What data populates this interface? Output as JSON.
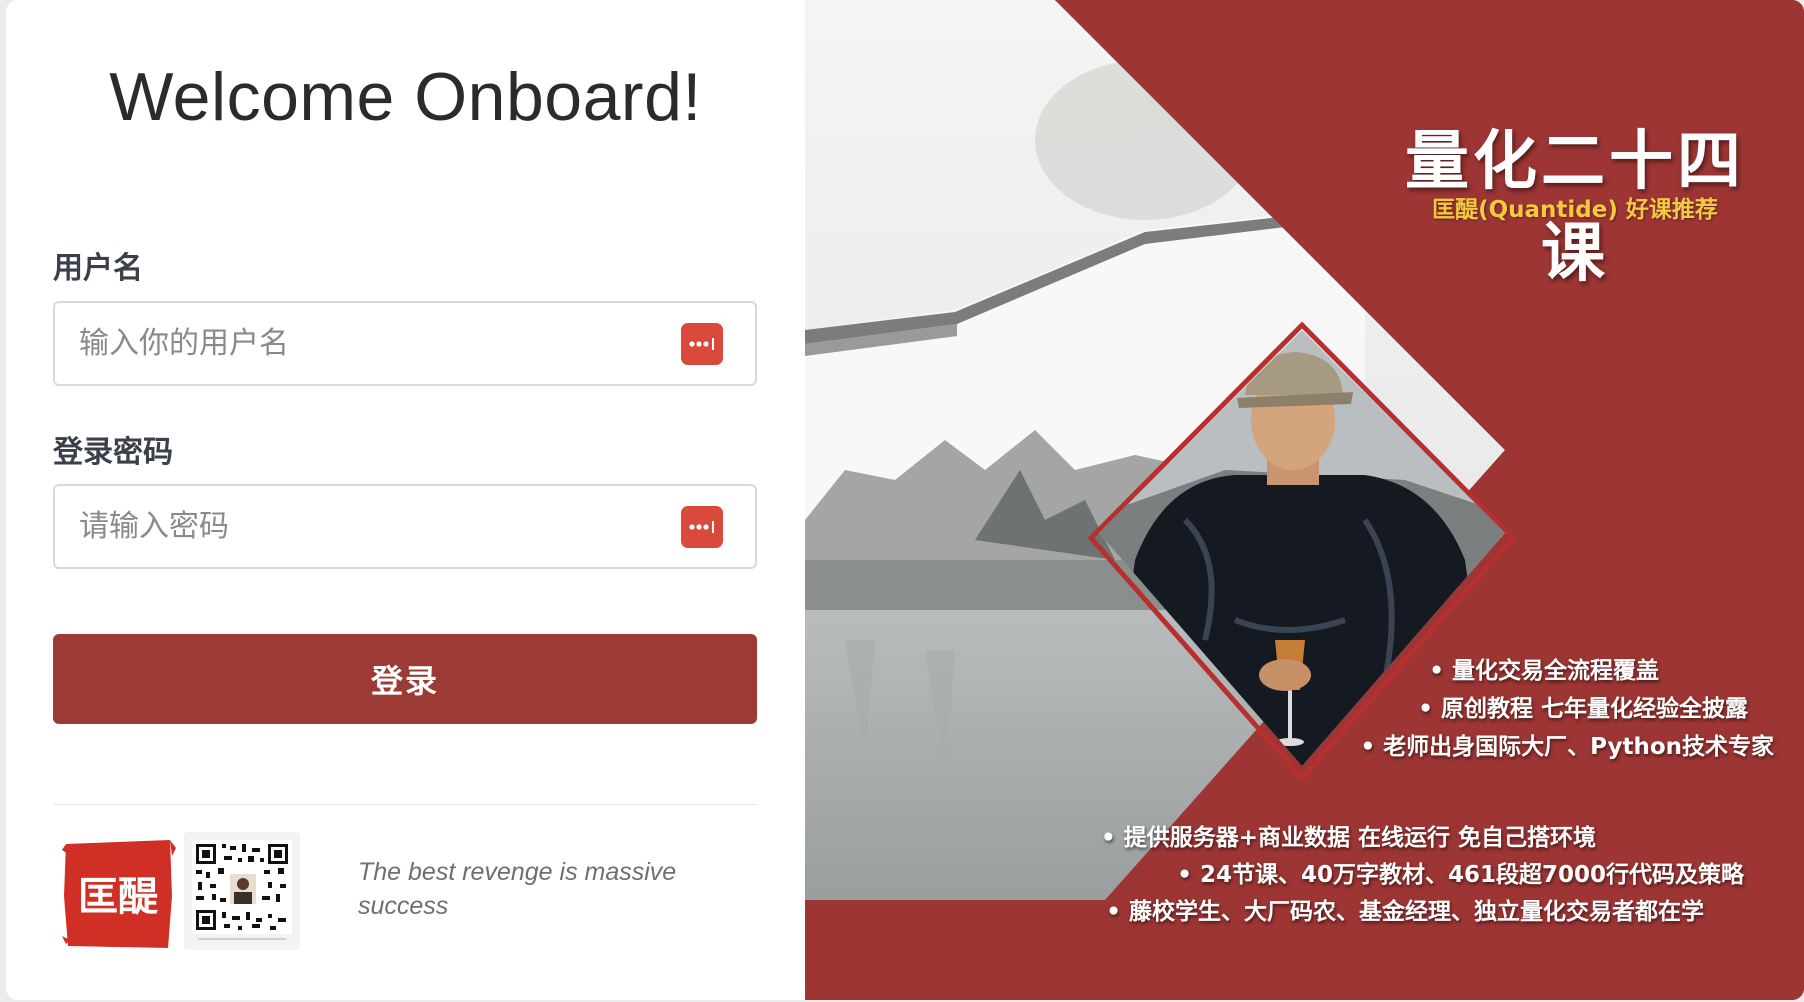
{
  "login": {
    "title": "Welcome Onboard!",
    "username_label": "用户名",
    "username_placeholder": "输入你的用户名",
    "password_label": "登录密码",
    "password_placeholder": "请输入密码",
    "submit_label": "登录",
    "quote": "The best revenge is massive success",
    "logo_text": "匡醍"
  },
  "promo": {
    "title": "量化二十四课",
    "subtitle": "匡醍(Quantide) 好课推荐",
    "features_top": [
      "量化交易全流程覆盖",
      "原创教程 七年量化经验全披露",
      "老师出身国际大厂、Python技术专家"
    ],
    "features_bottom": [
      "提供服务器+商业数据 在线运行 免自己搭环境",
      "24节课、40万字教材、461段超7000行代码及策略",
      "藤校学生、大厂码农、基金经理、独立量化交易者都在学"
    ]
  },
  "colors": {
    "accent": "#9c3a36",
    "icon_red": "#d94a3d",
    "promo_bg": "#9c3533",
    "subtitle_yellow": "#f5c842"
  },
  "icons": {
    "password_manager": "password-dots-icon"
  }
}
